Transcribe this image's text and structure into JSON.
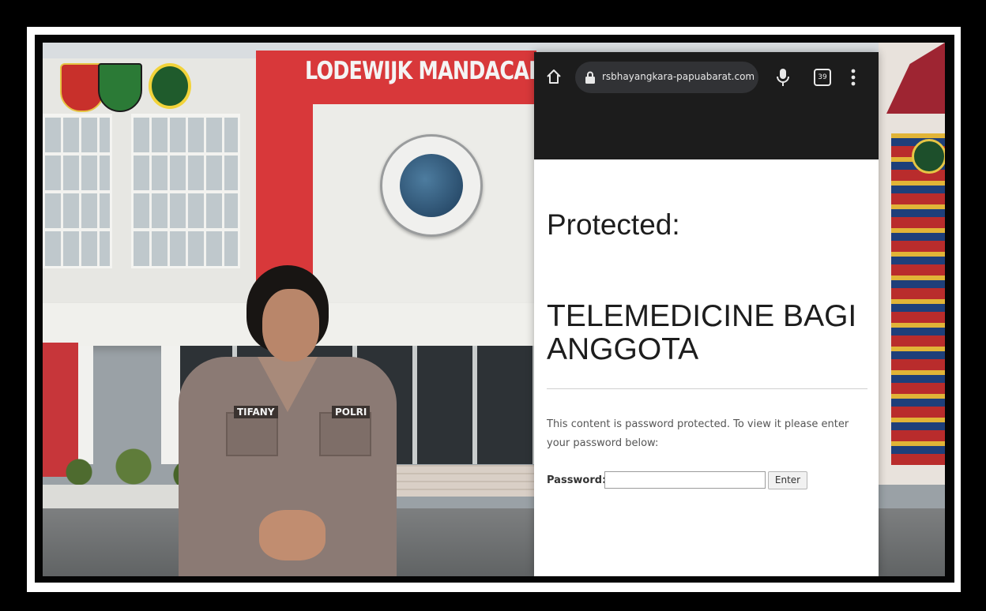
{
  "scene": {
    "building_sign": "LODEWIJK MANDACAN",
    "officer_name_tag": "TIFANY",
    "officer_unit_tag": "POLRI"
  },
  "browser": {
    "url": "rsbhayangkara-papuabarat.com/t",
    "tab_count": "39"
  },
  "page": {
    "protected_heading": "Protected:",
    "post_title": "TELEMEDICINE BAGI ANGGOTA",
    "message": "This content is password protected. To view it please enter your password below:",
    "password_label": "Password:",
    "password_value": "",
    "enter_label": "Enter"
  },
  "colors": {
    "browser_bar": "#1c1c1c",
    "url_pill": "#313235",
    "facade_red": "#d8383a"
  },
  "icons": [
    "home-icon",
    "lock-icon",
    "mic-icon",
    "tab-switcher-icon",
    "more-menu-icon"
  ]
}
